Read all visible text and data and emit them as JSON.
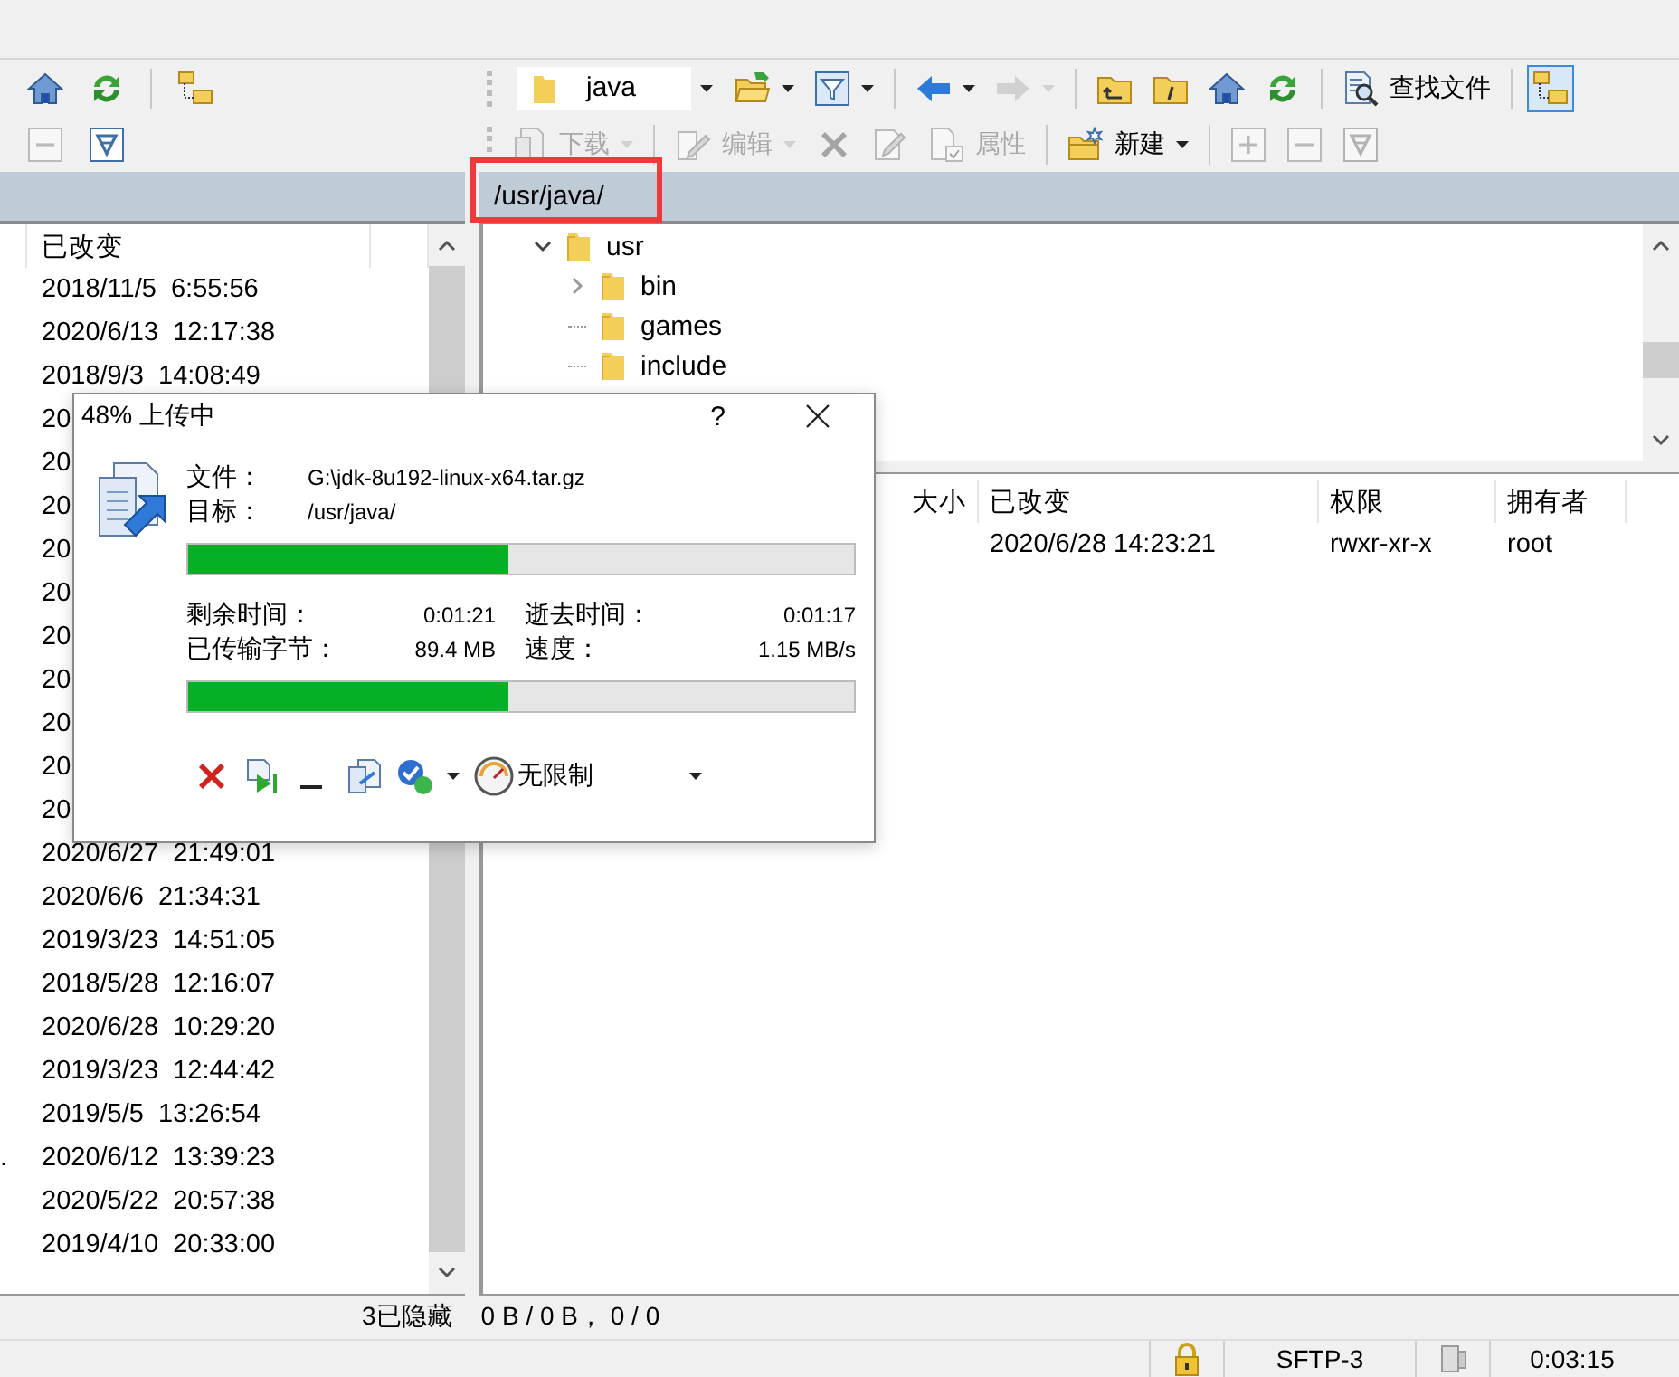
{
  "left_toolbar": {
    "row_1": [
      {
        "kind": "home",
        "disabled": false
      },
      {
        "kind": "refresh",
        "disabled": false
      },
      {
        "kind": "separator"
      },
      {
        "kind": "tree",
        "disabled": false,
        "selected": false
      }
    ],
    "row_2": [
      {
        "kind": "minus",
        "disabled": true
      },
      {
        "kind": "filter",
        "disabled": false
      }
    ]
  },
  "right_toolbar": {
    "row_1": [
      {
        "kind": "location",
        "value": "java"
      },
      {
        "kind": "open",
        "disabled": false,
        "dropdown": true
      },
      {
        "kind": "filter_menu",
        "disabled": false,
        "dropdown": true
      },
      {
        "kind": "separator"
      },
      {
        "kind": "back",
        "disabled": false,
        "dropdown": true
      },
      {
        "kind": "forward",
        "disabled": true,
        "dropdown": true
      },
      {
        "kind": "separator"
      },
      {
        "kind": "parent",
        "disabled": false
      },
      {
        "kind": "root",
        "disabled": false
      },
      {
        "kind": "home",
        "disabled": false
      },
      {
        "kind": "refresh",
        "disabled": false
      },
      {
        "kind": "separator"
      },
      {
        "kind": "find",
        "label": "查找文件",
        "disabled": false
      },
      {
        "kind": "separator"
      },
      {
        "kind": "tree",
        "disabled": false,
        "selected": true
      }
    ],
    "row_2": [
      {
        "kind": "download",
        "label": "下载",
        "disabled": true,
        "dropdown": true
      },
      {
        "kind": "separator"
      },
      {
        "kind": "edit",
        "label": "编辑",
        "disabled": true,
        "dropdown": true
      },
      {
        "kind": "delete",
        "disabled": true
      },
      {
        "kind": "rename",
        "disabled": true
      },
      {
        "kind": "properties",
        "label": "属性",
        "disabled": true
      },
      {
        "kind": "separator"
      },
      {
        "kind": "new",
        "label": "新建",
        "disabled": false,
        "dropdown": true
      },
      {
        "kind": "separator"
      },
      {
        "kind": "plus",
        "disabled": true
      },
      {
        "kind": "minus",
        "disabled": true
      },
      {
        "kind": "filter",
        "disabled": true
      }
    ]
  },
  "left_file_list": {
    "columns": [
      "已改变"
    ],
    "rows": [
      {
        "modified": "2018/11/5  6:55:56"
      },
      {
        "modified": "2020/6/13  12:17:38"
      },
      {
        "modified": "2018/9/3  14:08:49"
      },
      {
        "modified": "20"
      },
      {
        "modified": "20"
      },
      {
        "modified": "20"
      },
      {
        "modified": "20"
      },
      {
        "modified": "20"
      },
      {
        "modified": "20"
      },
      {
        "modified": "20"
      },
      {
        "modified": "20"
      },
      {
        "modified": "20"
      },
      {
        "modified": "20"
      },
      {
        "modified": "2020/6/27  21:49:01"
      },
      {
        "modified": "2020/6/6  21:34:31"
      },
      {
        "modified": "2019/3/23  14:51:05"
      },
      {
        "modified": "2018/5/28  12:16:07"
      },
      {
        "modified": "2020/6/28  10:29:20"
      },
      {
        "modified": "2019/3/23  12:44:42"
      },
      {
        "modified": "2019/5/5  13:26:54"
      },
      {
        "column_1": ".",
        "modified": "2020/6/12  13:39:23"
      },
      {
        "modified": "2020/5/22  20:57:38"
      },
      {
        "modified": "2019/4/10  20:33:00"
      }
    ]
  },
  "remote_path": {
    "path": "/usr/java/",
    "highlighted": true
  },
  "remote_tree": [
    {
      "label": "usr",
      "expanded": true,
      "children": [
        {
          "label": "bin",
          "expanded": false
        },
        {
          "label": "games"
        },
        {
          "label": "include"
        }
      ]
    }
  ],
  "remote_file_list": {
    "columns": [
      "大小",
      "已改变",
      "权限",
      "拥有者"
    ],
    "rows": [
      {
        "modified": "2020/6/28 14:23:21",
        "permissions": "rwxr-xr-x",
        "owner": "root"
      }
    ]
  },
  "status_bar": {
    "hidden": "3已隐藏",
    "selection": "0 B / 0 B， 0 / 0"
  },
  "session_bar": {
    "protocol": "SFTP-3",
    "elapsed": "0:03:15"
  },
  "transfer_dialog": {
    "title": "48% 上传中",
    "help": "?",
    "fields": [
      {
        "label": "文件：",
        "value": "G:\\jdk-8u192-linux-x64.tar.gz"
      },
      {
        "label": "目标：",
        "value": "/usr/java/"
      }
    ],
    "file_progress": {
      "level": 0.48
    },
    "stats": [
      {
        "label": "剩余时间：",
        "value": "0:01:21"
      },
      {
        "label": "逝去时间：",
        "value": "0:01:17"
      },
      {
        "label": "已传输字节：",
        "value": "89.4 MB"
      },
      {
        "label": "速度：",
        "value": "1.15 MB/s"
      }
    ],
    "total_progress": {
      "level": 0.48
    },
    "speed_limit": "无限制"
  }
}
